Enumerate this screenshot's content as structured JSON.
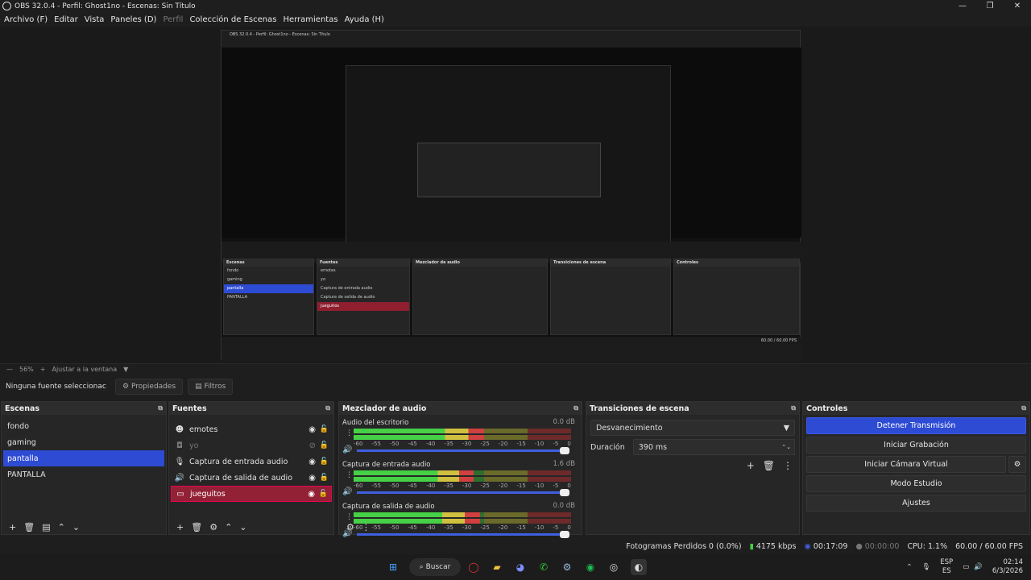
{
  "window": {
    "title": "OBS 32.0.4 - Perfil: Ghost1no - Escenas: Sin Título"
  },
  "menu": [
    "Archivo (F)",
    "Editar",
    "Vista",
    "Paneles (D)",
    "Perfil",
    "Colección de Escenas",
    "Herramientas",
    "Ayuda (H)"
  ],
  "zoom": {
    "level": "56%",
    "fit_label": "Ajustar a la ventana"
  },
  "source_bar": {
    "no_source": "Ninguna fuente seleccionac",
    "properties": "Propiedades",
    "filters": "Filtros"
  },
  "scenes": {
    "title": "Escenas",
    "items": [
      "fondo",
      "gaming",
      "pantalla",
      "PANTALLA"
    ],
    "selected": "pantalla"
  },
  "sources": {
    "title": "Fuentes",
    "items": [
      {
        "name": "emotes",
        "icon": "emote-icon",
        "visible": true
      },
      {
        "name": "yo",
        "icon": "camera-icon",
        "visible": false
      },
      {
        "name": "Captura de entrada audio",
        "icon": "mic-icon",
        "visible": true
      },
      {
        "name": "Captura de salida de audio",
        "icon": "speaker-icon",
        "visible": true
      },
      {
        "name": "jueguitos",
        "icon": "monitor-icon",
        "visible": true,
        "highlighted": true
      }
    ]
  },
  "mixer": {
    "title": "Mezclador de audio",
    "channels": [
      {
        "name": "Audio del escritorio",
        "db": "0.0 dB",
        "level": 0.6
      },
      {
        "name": "Captura de entrada audio",
        "db": "1.6 dB",
        "level": 0.55
      },
      {
        "name": "Captura de salida de audio",
        "db": "0.0 dB",
        "level": 0.58
      }
    ],
    "ticks": [
      "-60",
      "-55",
      "-50",
      "-45",
      "-40",
      "-35",
      "-30",
      "-25",
      "-20",
      "-15",
      "-10",
      "-5",
      "0"
    ]
  },
  "transitions": {
    "title": "Transiciones de escena",
    "selected": "Desvanecimiento",
    "duration_label": "Duración",
    "duration_value": "390 ms"
  },
  "controls": {
    "title": "Controles",
    "stop_stream": "Detener Transmisión",
    "start_record": "Iniciar Grabación",
    "virtual_cam": "Iniciar Cámara Virtual",
    "studio_mode": "Modo Estudio",
    "settings": "Ajustes"
  },
  "status": {
    "dropped": "Fotogramas Perdidos 0 (0.0%)",
    "bitrate": "4175 kbps",
    "stream_time": "00:17:09",
    "record_time": "00:00:00",
    "cpu": "CPU: 1.1%",
    "fps": "60.00 / 60.00 FPS"
  },
  "taskbar": {
    "search": "Buscar",
    "lang_top": "ESP",
    "lang_bottom": "ES",
    "time": "02:14",
    "date": "6/3/2026"
  },
  "colors": {
    "accent": "#2e4bd4",
    "highlight_red": "#922135",
    "background": "#1e1e1e"
  }
}
